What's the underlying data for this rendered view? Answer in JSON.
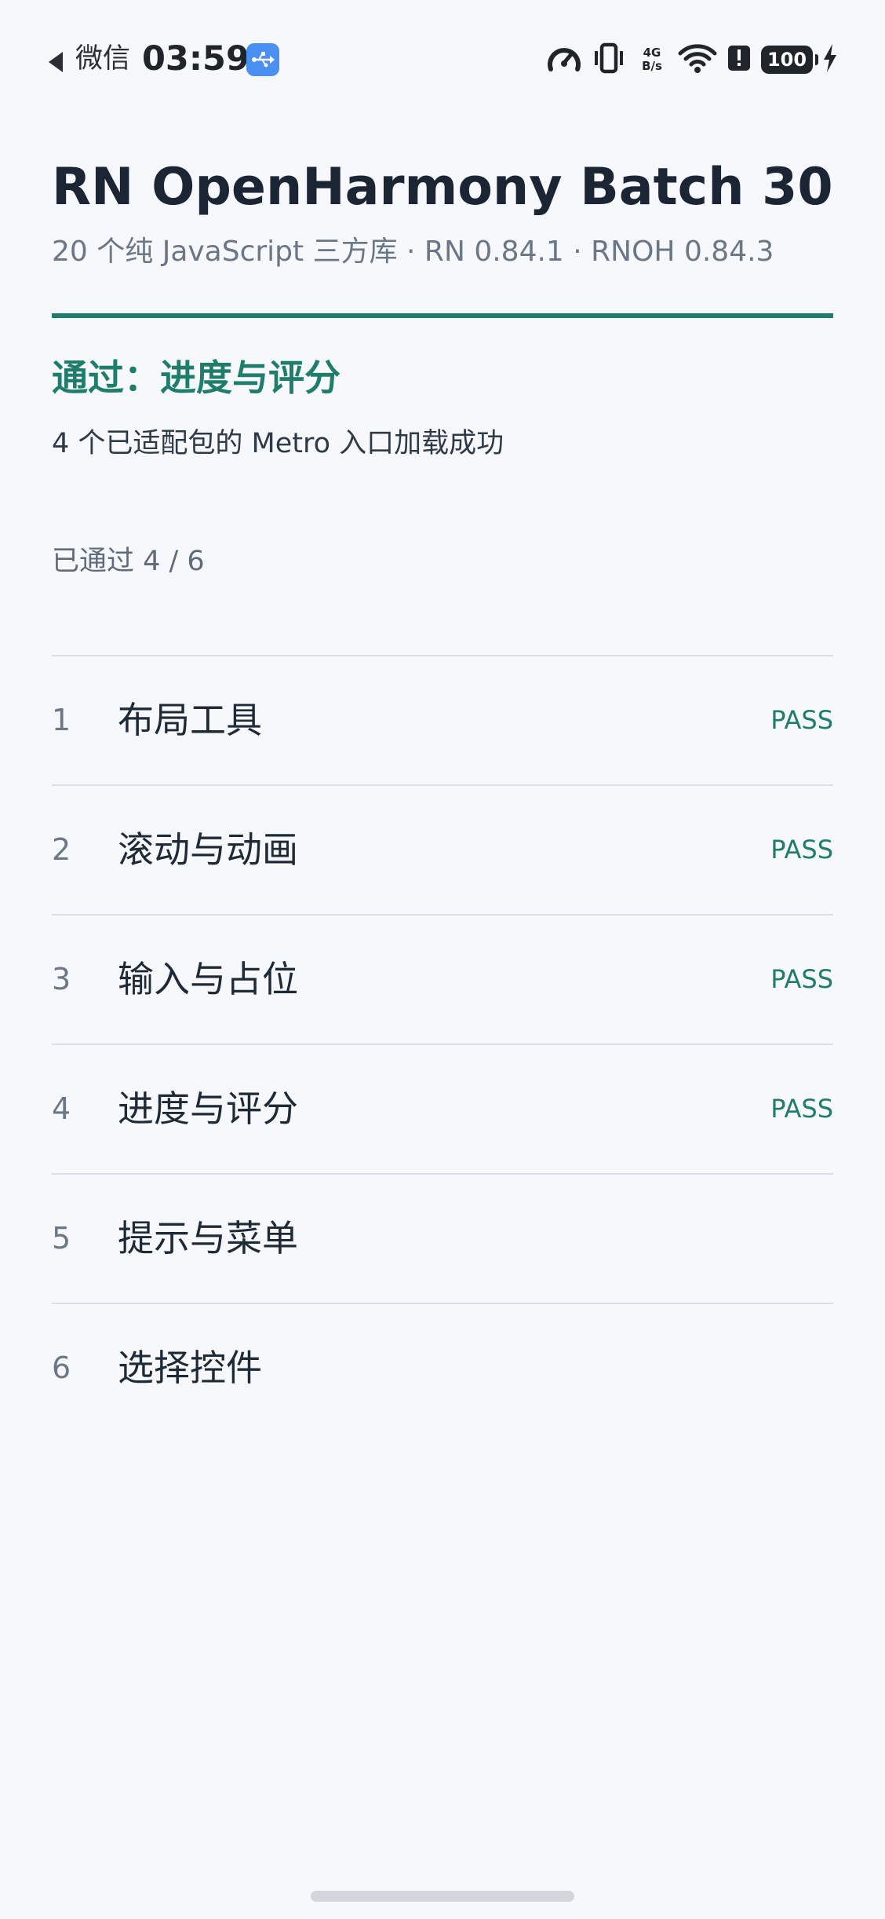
{
  "status_bar": {
    "back_app": "微信",
    "time": "03:59",
    "net_speed_top": "4G",
    "net_speed_bottom": "B/s",
    "battery": "100",
    "icons": [
      "back-arrow-icon",
      "usb-icon",
      "speed-gauge-icon",
      "vibrate-icon",
      "signal-icon",
      "wifi-icon",
      "alert-icon",
      "battery-icon",
      "charging-icon"
    ]
  },
  "header": {
    "title": "RN OpenHarmony Batch 30",
    "subtitle": "20 个纯 JavaScript 三方库 · RN 0.84.1 · RNOH 0.84.3"
  },
  "result": {
    "title": "通过：进度与评分",
    "detail": "4 个已适配包的 Metro 入口加载成功",
    "progress": "已通过 4 / 6"
  },
  "tests": [
    {
      "num": "1",
      "name": "布局工具",
      "status": "PASS"
    },
    {
      "num": "2",
      "name": "滚动与动画",
      "status": "PASS"
    },
    {
      "num": "3",
      "name": "输入与占位",
      "status": "PASS"
    },
    {
      "num": "4",
      "name": "进度与评分",
      "status": "PASS"
    },
    {
      "num": "5",
      "name": "提示与菜单",
      "status": ""
    },
    {
      "num": "6",
      "name": "选择控件",
      "status": ""
    }
  ],
  "colors": {
    "accent": "#1f7d6b",
    "background": "#f6f8fb",
    "divider": "#d9dee7",
    "usb_badge": "#4a8ff2"
  }
}
